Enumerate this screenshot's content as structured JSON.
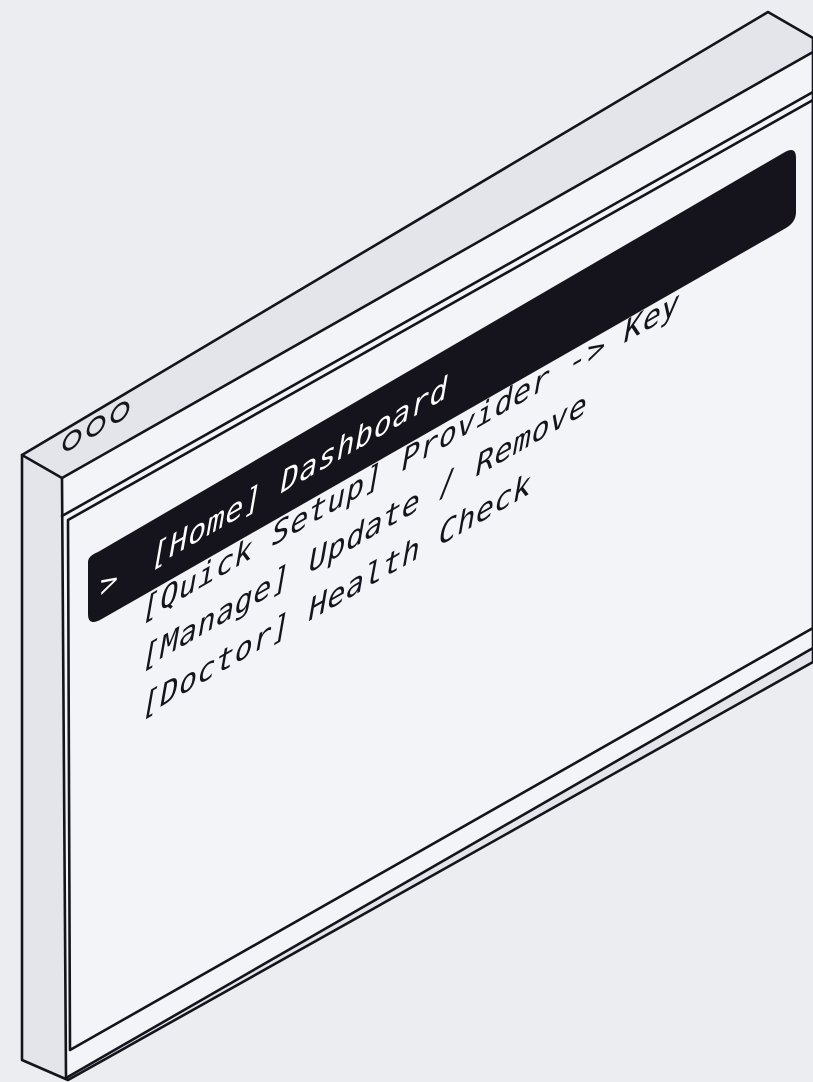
{
  "colors": {
    "background": "#ebedf1",
    "ink": "#15141d",
    "window_fill": "#f3f4f7",
    "selected_bar": "#15141d",
    "selected_text": "#ffffff"
  },
  "window": {
    "controls": [
      "window-dot-icon",
      "window-dot-icon",
      "window-dot-icon"
    ]
  },
  "menu": {
    "selected_index": 0,
    "items": [
      {
        "marker": ">",
        "label": "[Home] Dashboard"
      },
      {
        "marker": "",
        "label": "[Quick Setup] Provider -> Key"
      },
      {
        "marker": "",
        "label": "[Manage] Update / Remove"
      },
      {
        "marker": "",
        "label": "[Doctor] Health Check"
      }
    ]
  }
}
